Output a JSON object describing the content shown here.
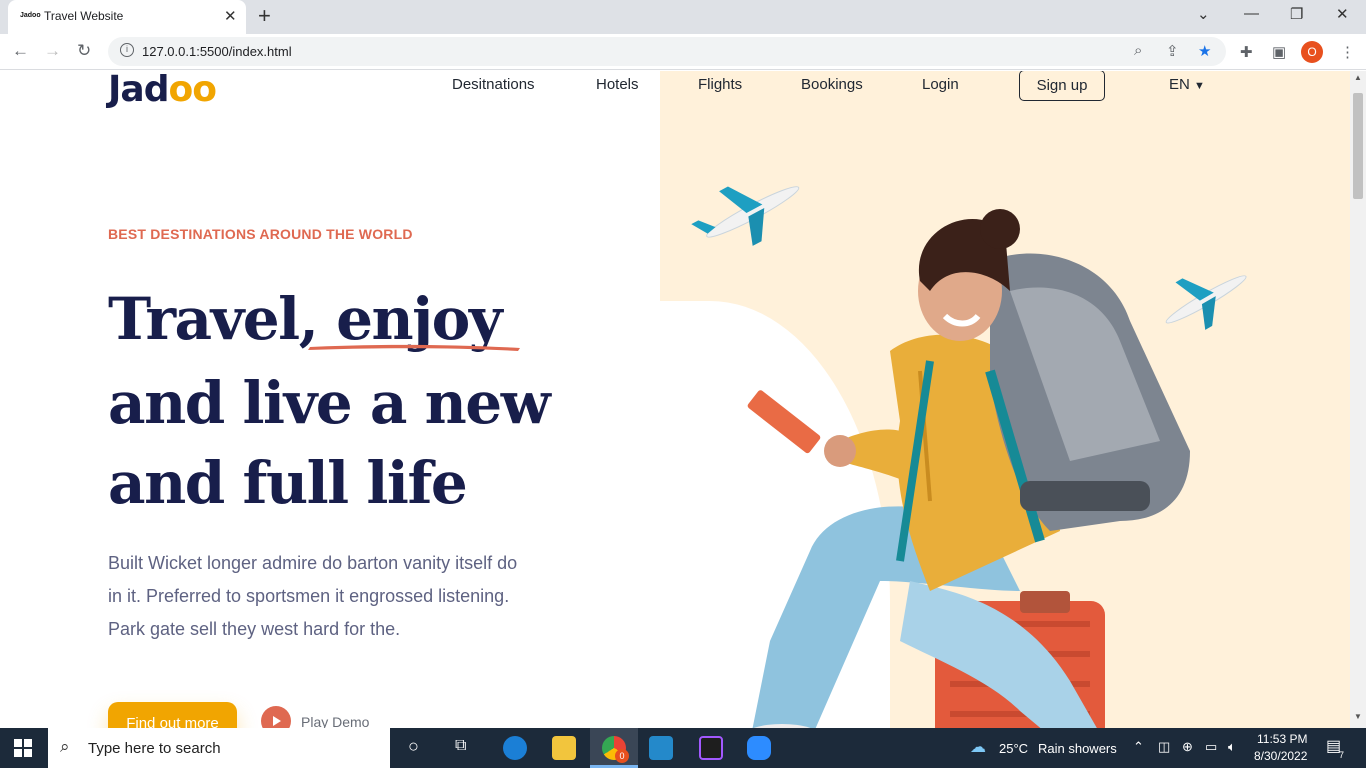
{
  "browser": {
    "tab_title": "Travel Website",
    "tab_favicon_text": "Jadoo",
    "url": "127.0.0.1:5500/index.html",
    "profile_initial": "O"
  },
  "site": {
    "logo_main": "Jad",
    "logo_accent": "oo",
    "nav": [
      "Desitnations",
      "Hotels",
      "Flights",
      "Bookings",
      "Login"
    ],
    "signup_label": "Sign up",
    "language": "EN",
    "tagline": "BEST DESTINATIONS AROUND THE WORLD",
    "hero_part1": "Travel, ",
    "hero_highlight": "enjoy",
    "hero_line2": "and live a new",
    "hero_line3": "and full life",
    "description": "Built Wicket longer admire do barton vanity itself do in it. Preferred to sportsmen it engrossed listening. Park gate sell they west hard for the.",
    "cta_label": "Find out more",
    "play_label": "Play Demo"
  },
  "colors": {
    "accent_orange": "#df6951",
    "accent_yellow": "#f1a501",
    "heading_navy": "#181e4b",
    "hero_bg": "#fff1da"
  },
  "taskbar": {
    "search_placeholder": "Type here to search",
    "weather_temp": "25°C",
    "weather_desc": "Rain showers",
    "time": "11:53 PM",
    "date": "8/30/2022",
    "notification_count": "7",
    "chrome_badge": "0"
  }
}
